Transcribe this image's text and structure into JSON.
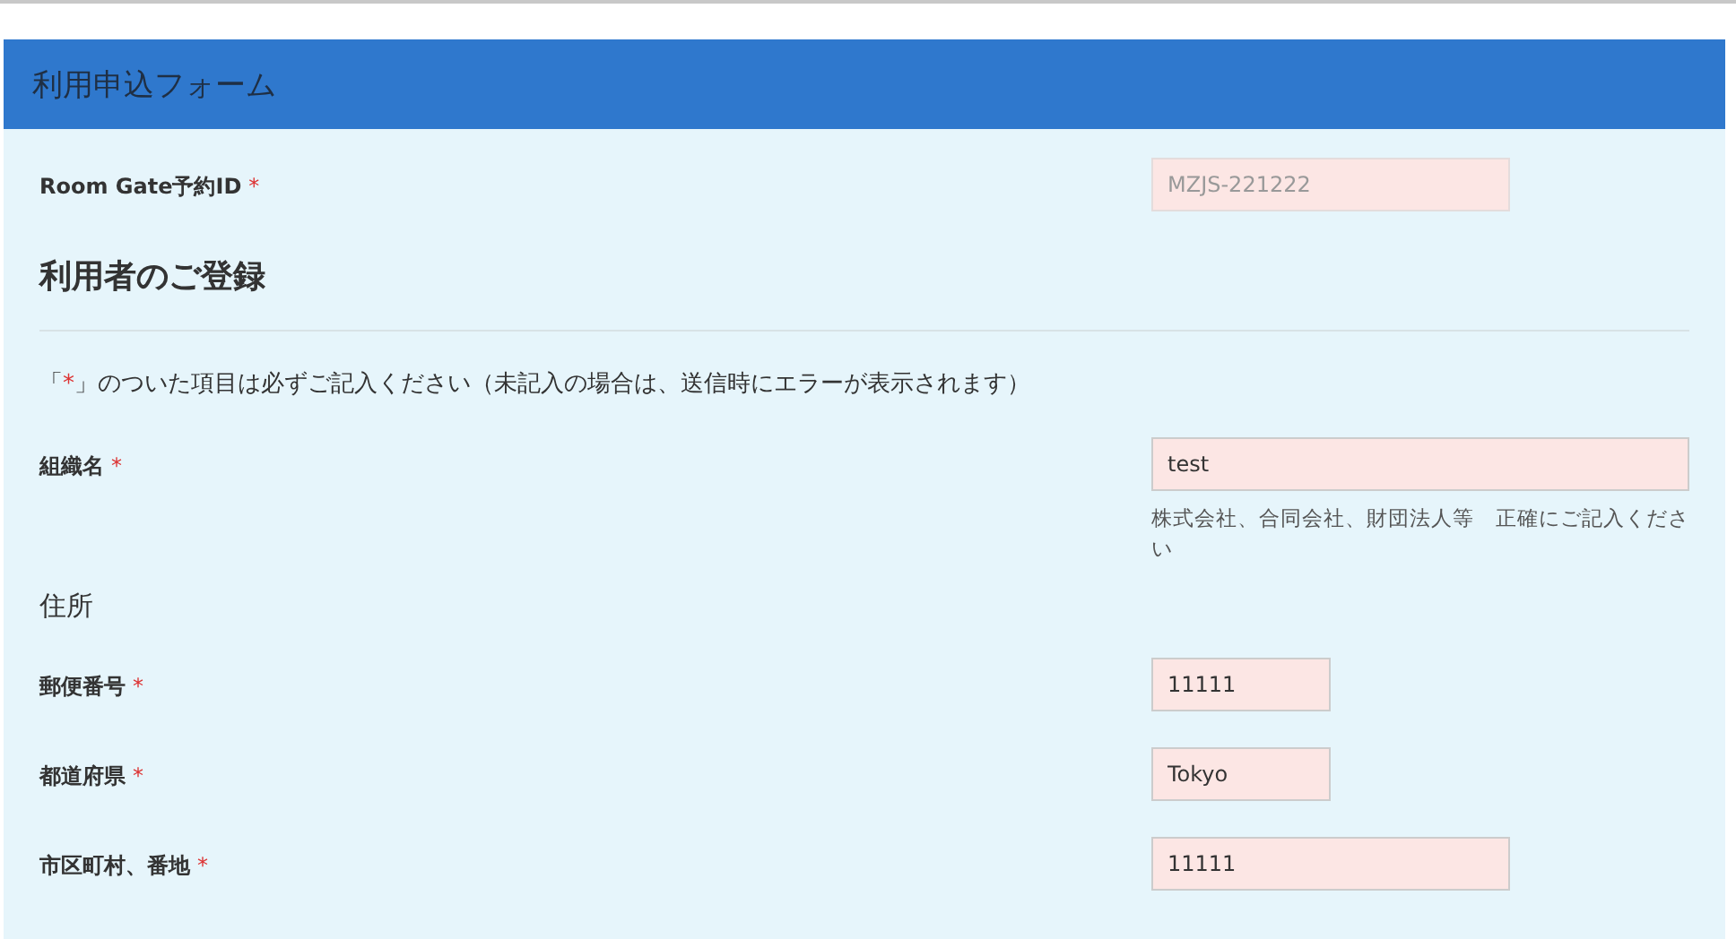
{
  "form_title": "利用申込フォーム",
  "id_field": {
    "label": "Room Gate予約ID",
    "required_mark": "*",
    "value": "MZJS-221222",
    "kind": "medium",
    "disabled": true
  },
  "section_title": "利用者のご登録",
  "notice": {
    "open": "「",
    "mark": "*",
    "rest": "」のついた項目は必ずご記入ください（未記入の場合は、送信時にエラーが表示されます）"
  },
  "org_field": {
    "label": "組織名",
    "required_mark": "*",
    "value": "test",
    "kind": "wide",
    "disabled": false,
    "hint": "株式会社、合同会社、財団法人等　正確にご記入ください"
  },
  "address_title": "住所",
  "address_fields": [
    {
      "label": "郵便番号",
      "required_mark": "*",
      "value": "11111",
      "kind": "narrow",
      "disabled": false
    },
    {
      "label": "都道府県",
      "required_mark": "*",
      "value": "Tokyo",
      "kind": "narrow",
      "disabled": false
    },
    {
      "label": "市区町村、番地",
      "required_mark": "*",
      "value": "11111",
      "kind": "medium",
      "disabled": false
    }
  ]
}
